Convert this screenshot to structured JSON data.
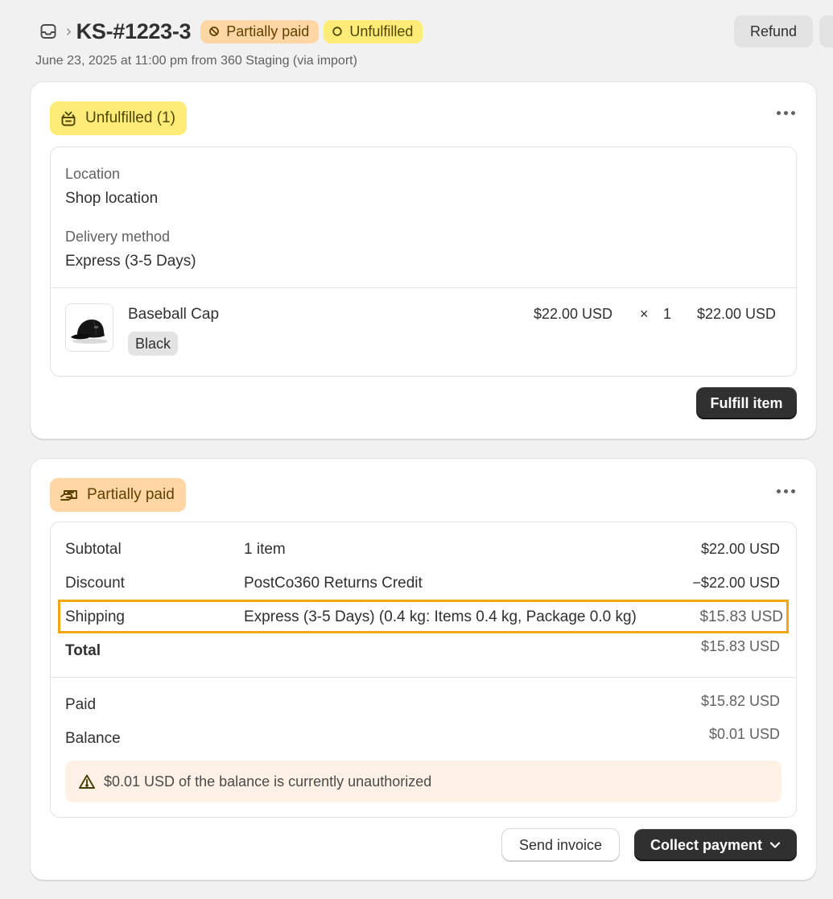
{
  "header": {
    "order_id": "KS-#1223-3",
    "payment_status": "Partially paid",
    "fulfillment_status": "Unfulfilled",
    "subtitle": "June 23, 2025 at 11:00 pm from 360 Staging (via import)",
    "refund_label": "Refund",
    "breadcrumb_sep": "›"
  },
  "fulfillment_card": {
    "badge": "Unfulfilled (1)",
    "location_label": "Location",
    "location_value": "Shop location",
    "delivery_label": "Delivery method",
    "delivery_value": "Express (3-5 Days)",
    "item": {
      "name": "Baseball Cap",
      "variant": "Black",
      "unit_price": "$22.00 USD",
      "times": "×",
      "quantity": "1",
      "total": "$22.00 USD"
    },
    "fulfill_button": "Fulfill item"
  },
  "payment_card": {
    "badge": "Partially paid",
    "rows": [
      {
        "label": "Subtotal",
        "desc": "1 item",
        "amount": "$22.00 USD"
      },
      {
        "label": "Discount",
        "desc": "PostCo360 Returns Credit",
        "amount": "−$22.00 USD"
      },
      {
        "label": "Shipping",
        "desc": "Express (3-5 Days) (0.4 kg: Items 0.4 kg, Package 0.0 kg)",
        "amount": "$15.83 USD"
      },
      {
        "label": "Total",
        "desc": "",
        "amount": "$15.83 USD"
      }
    ],
    "paid_label": "Paid",
    "paid_amount": "$15.82 USD",
    "balance_label": "Balance",
    "balance_amount": "$0.01 USD",
    "warning": "$0.01 USD of the balance is currently unauthorized",
    "send_invoice": "Send invoice",
    "collect_payment": "Collect payment"
  },
  "colors": {
    "unfulfilled_bg": "#ffeb78",
    "partially_paid_bg": "#ffd6a4",
    "highlight_border": "#f2a413",
    "primary_button": "#303030"
  }
}
